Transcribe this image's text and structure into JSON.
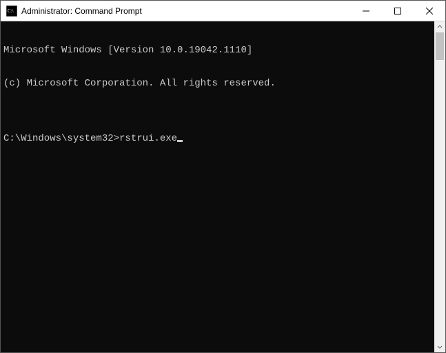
{
  "window": {
    "title": "Administrator: Command Prompt",
    "icon_name": "cmd-icon"
  },
  "terminal": {
    "line1": "Microsoft Windows [Version 10.0.19042.1110]",
    "line2": "(c) Microsoft Corporation. All rights reserved.",
    "blank": "",
    "prompt": "C:\\Windows\\system32>",
    "command": "rstrui.exe"
  }
}
